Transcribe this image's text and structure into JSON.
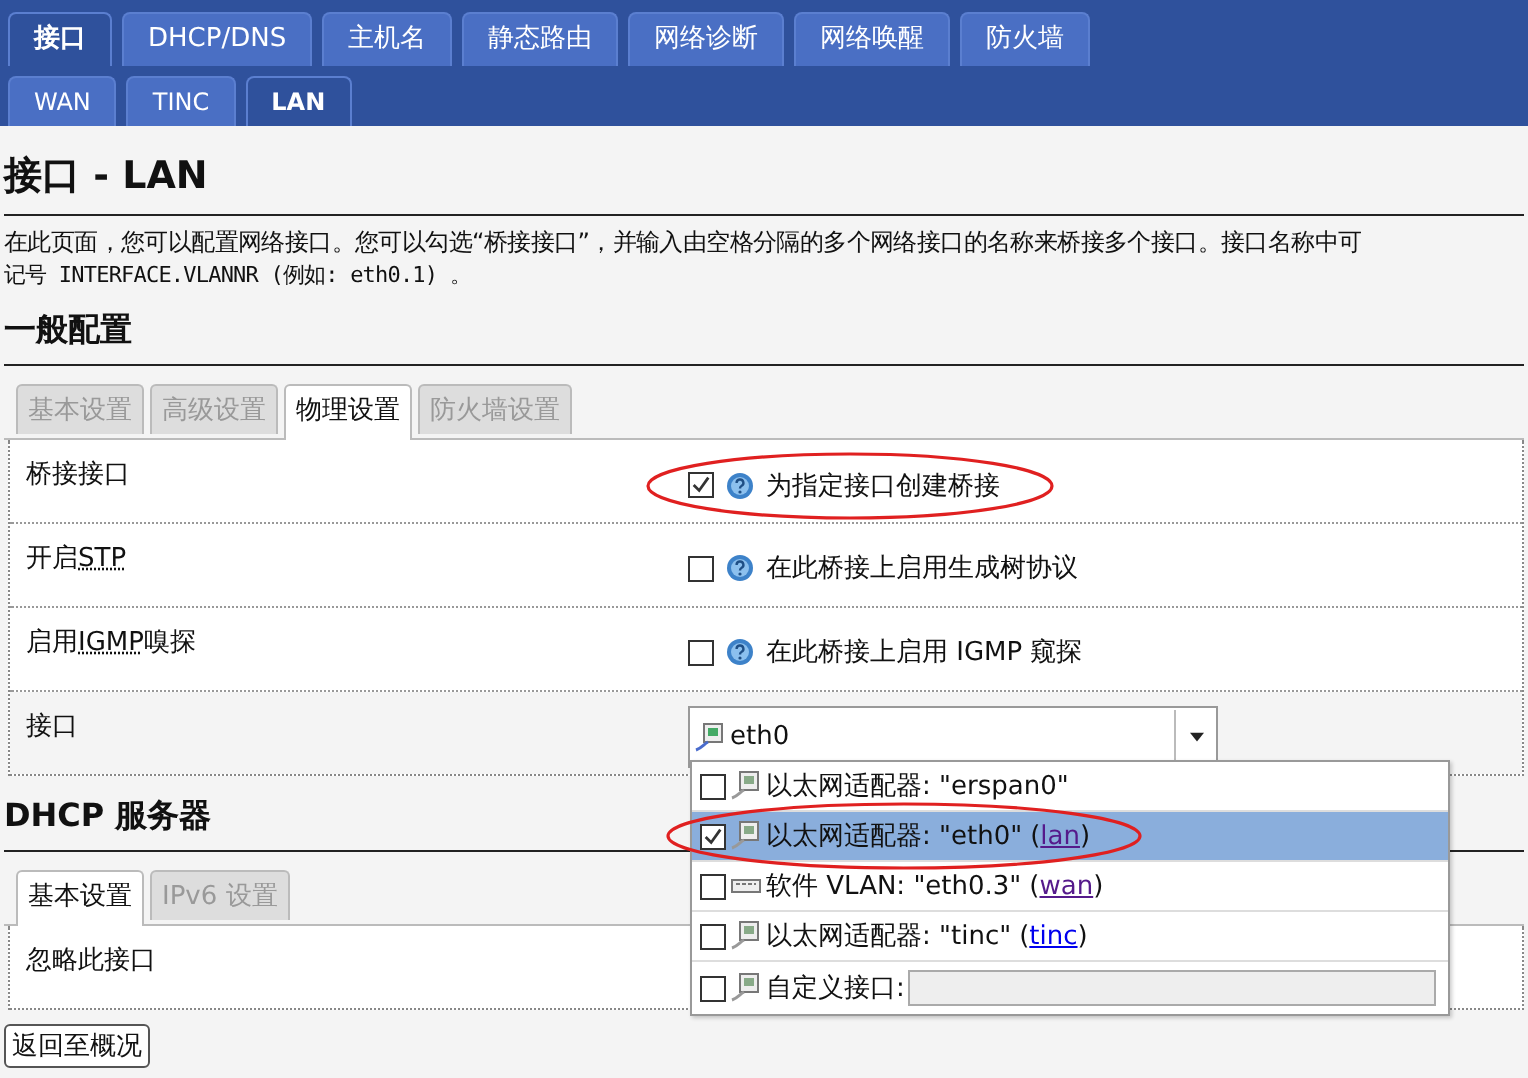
{
  "top_tabs": [
    {
      "label": "接口",
      "selected": true
    },
    {
      "label": "DHCP/DNS",
      "selected": false
    },
    {
      "label": "主机名",
      "selected": false
    },
    {
      "label": "静态路由",
      "selected": false
    },
    {
      "label": "网络诊断",
      "selected": false
    },
    {
      "label": "网络唤醒",
      "selected": false
    },
    {
      "label": "防火墙",
      "selected": false
    }
  ],
  "sub_tabs": [
    {
      "label": "WAN",
      "selected": false
    },
    {
      "label": "TINC",
      "selected": false
    },
    {
      "label": "LAN",
      "selected": true
    }
  ],
  "page_title": "接口 - LAN",
  "description": [
    "在此页面，您可以配置网络接口。您可以勾选“桥接接口”，并输入由空格分隔的多个网络接口的名称来桥接多个接口。接口名称中可",
    "记号 INTERFACE.VLANNR (例如: eth0.1) 。"
  ],
  "general": {
    "title": "一般配置",
    "tabs": [
      {
        "label": "基本设置",
        "selected": false
      },
      {
        "label": "高级设置",
        "selected": false
      },
      {
        "label": "物理设置",
        "selected": true
      },
      {
        "label": "防火墙设置",
        "selected": false
      }
    ],
    "rows": [
      {
        "kind": "checkbox",
        "label": "桥接接口",
        "checked": true,
        "hint": "为指定接口创建桥接",
        "circled": true
      },
      {
        "kind": "checkbox",
        "label": "开启",
        "abbr": "STP",
        "checked": false,
        "hint": "在此桥接上启用生成树协议",
        "circled": false
      },
      {
        "kind": "checkbox",
        "label": "启用",
        "abbr": "IGMP",
        "label_after": "嗅探",
        "checked": false,
        "hint": "在此桥接上启用 IGMP 窥探",
        "circled": false
      },
      {
        "kind": "select",
        "label": "接口",
        "value": "eth0"
      }
    ]
  },
  "dropdown": {
    "items": [
      {
        "kind": "ethernet",
        "checked": false,
        "selected": false,
        "text": "以太网适配器: \"erspan0\"",
        "circled": false
      },
      {
        "kind": "ethernet",
        "checked": true,
        "selected": true,
        "text": "以太网适配器: \"eth0\"",
        "link_before": "(",
        "link": "lan",
        "link_after": ")",
        "visited": true,
        "circled": true
      },
      {
        "kind": "vlan",
        "checked": false,
        "selected": false,
        "text": "软件 VLAN: \"eth0.3\"",
        "link_before": "(",
        "link": "wan",
        "link_after": ")",
        "visited": true,
        "circled": false
      },
      {
        "kind": "ethernet",
        "checked": false,
        "selected": false,
        "text": "以太网适配器: \"tinc\"",
        "link_before": "(",
        "link": "tinc",
        "link_after": ")",
        "visited": false,
        "circled": false
      },
      {
        "kind": "custom",
        "checked": false,
        "selected": false,
        "text": "自定义接口:",
        "circled": false
      }
    ]
  },
  "dhcp": {
    "title": "DHCP 服务器",
    "tabs": [
      {
        "label": "基本设置",
        "selected": true
      },
      {
        "label": "IPv6 设置",
        "selected": false
      }
    ],
    "rows": [
      {
        "label": "忽略此接口"
      }
    ]
  },
  "back_button": "返回至概况"
}
